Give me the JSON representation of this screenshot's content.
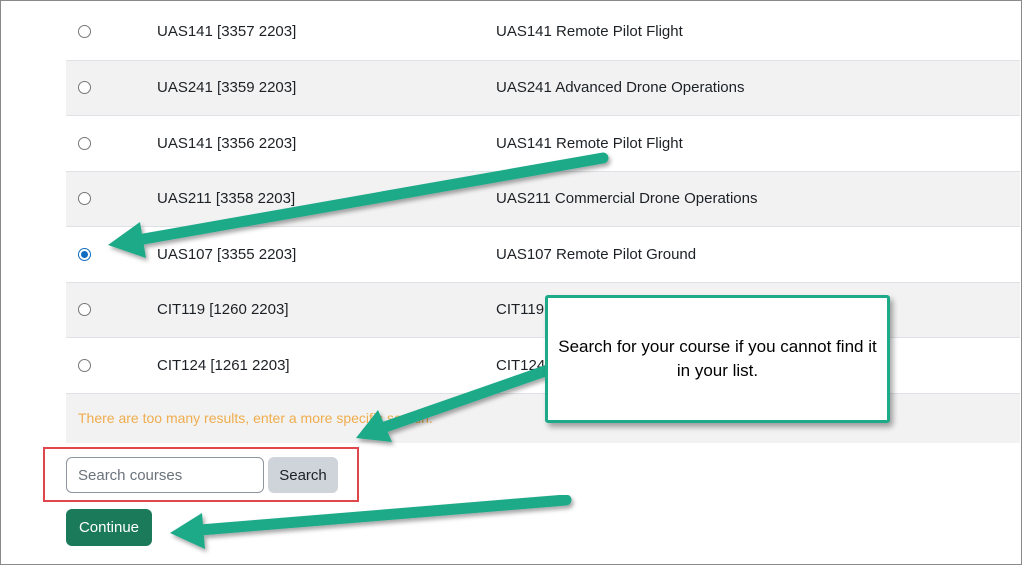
{
  "courses": [
    {
      "code": "UAS141 [3357 2203]",
      "name": "UAS141 Remote Pilot Flight",
      "selected": false
    },
    {
      "code": "UAS241 [3359 2203]",
      "name": "UAS241 Advanced Drone Operations",
      "selected": false
    },
    {
      "code": "UAS141 [3356 2203]",
      "name": "UAS141 Remote Pilot Flight",
      "selected": false
    },
    {
      "code": "UAS211 [3358 2203]",
      "name": "UAS211 Commercial Drone Operations",
      "selected": false
    },
    {
      "code": "UAS107 [3355 2203]",
      "name": "UAS107 Remote Pilot Ground",
      "selected": true
    },
    {
      "code": "CIT119 [1260 2203]",
      "name": "CIT119",
      "selected": false
    },
    {
      "code": "CIT124 [1261 2203]",
      "name": "CIT124",
      "selected": false
    }
  ],
  "warning_text": "There are too many results, enter a more specific search.",
  "search": {
    "placeholder": "Search courses",
    "button_label": "Search"
  },
  "continue_label": "Continue",
  "callout_text": "Search for your course if you cannot find it in your list.",
  "colors": {
    "arrow": "#1daa89",
    "highlight": "#e0474c",
    "primary": "#1b7a5a",
    "warning": "#f0ad4e",
    "radio": "#0f6cbf"
  }
}
